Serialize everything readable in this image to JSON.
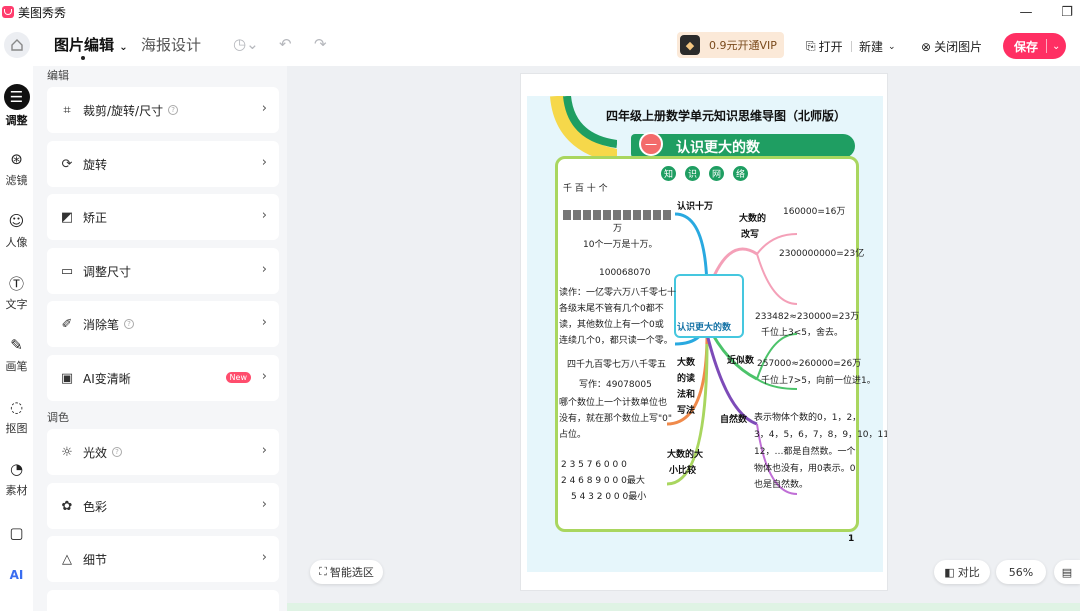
{
  "app": {
    "title": "美图秀秀"
  },
  "toolbar": {
    "tab_active": "图片编辑",
    "tab_other": "海报设计",
    "vip_label": "0.9元开通VIP",
    "open_label": "打开",
    "new_label": "新建",
    "close_label": "关闭图片",
    "save_label": "保存"
  },
  "rail": [
    {
      "label": "调整",
      "icon": "sliders-icon"
    },
    {
      "label": "滤镜",
      "icon": "filter-icon"
    },
    {
      "label": "人像",
      "icon": "portrait-icon"
    },
    {
      "label": "文字",
      "icon": "text-icon"
    },
    {
      "label": "画笔",
      "icon": "brush-icon"
    },
    {
      "label": "抠图",
      "icon": "cutout-icon"
    },
    {
      "label": "素材",
      "icon": "sticker-icon"
    }
  ],
  "panel": {
    "section_edit": "编辑",
    "section_color": "调色",
    "items": [
      {
        "label": "裁剪/旋转/尺寸",
        "icon": "crop-icon"
      },
      {
        "label": "旋转",
        "icon": "rotate-icon"
      },
      {
        "label": "矫正",
        "icon": "straighten-icon"
      },
      {
        "label": "调整尺寸",
        "icon": "resize-icon"
      },
      {
        "label": "消除笔",
        "icon": "eraser-icon"
      },
      {
        "label": "AI变清晰",
        "icon": "ai-enhance-icon",
        "badge": "New"
      },
      {
        "label": "光效",
        "icon": "light-icon"
      },
      {
        "label": "色彩",
        "icon": "color-icon"
      },
      {
        "label": "细节",
        "icon": "detail-icon"
      }
    ]
  },
  "canvas": {
    "smart_select": "智能选区",
    "compare": "对比",
    "zoom": "56%"
  },
  "poster": {
    "title": "四年级上册数学单元知识思维导图（北师版）",
    "banner_num": "一",
    "banner_text": "认识更大的数",
    "pills": [
      "知",
      "识",
      "网",
      "络"
    ],
    "center": "认识更大的数",
    "places": "千  百  十  个",
    "wan": "万",
    "ten_wan": "10个一万是十万。",
    "know_shiwan": "认识十万",
    "big_read": "大数的",
    "big_write": "改写",
    "eq1": "160000=16万",
    "eq2": "2300000000=23亿",
    "num1": "100068070",
    "read1a": "读作：一亿零六万八千零七十",
    "read1b": "各级末尾不管有几个0都不",
    "read1c": "读，其他数位上有一个0或",
    "read1d": "连续几个0，都只读一个零。",
    "approx1": "233482≈230000=23万",
    "approx1n": "千位上3<5，舍去。",
    "approx_label": "近似数",
    "approx2": "257000≈260000=26万",
    "approx2n": "千位上7>5，向前一位进1。",
    "write1": "四千九百零七万八千零五",
    "write2": "写作：49078005",
    "rw1": "大数",
    "rw2": "的读",
    "rw3": "法和",
    "rw4": "写法",
    "write3": "哪个数位上一个计数单位也",
    "write4": "没有，就在那个数位上写\"0\"",
    "write5": "占位。",
    "natural": "自然数",
    "n1": "表示物体个数的0，1，2，",
    "n2": "3，4，5，6，7，8，9，10，11，",
    "n3": "12，…都是自然数。一个",
    "n4": "物体也没有，用0表示。0",
    "n5": "也是自然数。",
    "cmp_label1": "大数的大",
    "cmp_label2": "小比较",
    "cmp1": "2 3 5 7 6 0 0 0",
    "cmp2": "2 4 6 8 9 0 0 0最大",
    "cmp3": "5 4 3 2 0 0 0最小",
    "page": "1"
  }
}
